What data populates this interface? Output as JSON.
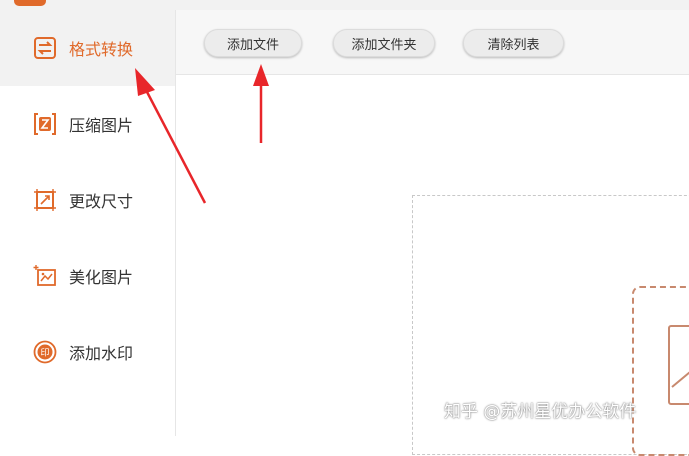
{
  "sidebar": {
    "items": [
      {
        "label": "格式转换",
        "icon": "format-convert-icon",
        "active": true
      },
      {
        "label": "压缩图片",
        "icon": "compress-icon",
        "active": false
      },
      {
        "label": "更改尺寸",
        "icon": "resize-icon",
        "active": false
      },
      {
        "label": "美化图片",
        "icon": "beautify-icon",
        "active": false
      },
      {
        "label": "添加水印",
        "icon": "watermark-icon",
        "active": false
      }
    ]
  },
  "toolbar": {
    "add_file_label": "添加文件",
    "add_folder_label": "添加文件夹",
    "clear_list_label": "清除列表"
  },
  "watermark": {
    "text": "知乎 @苏州星优办公软件"
  },
  "colors": {
    "accent": "#e06a2b",
    "annotation_arrow": "#e8262a"
  }
}
